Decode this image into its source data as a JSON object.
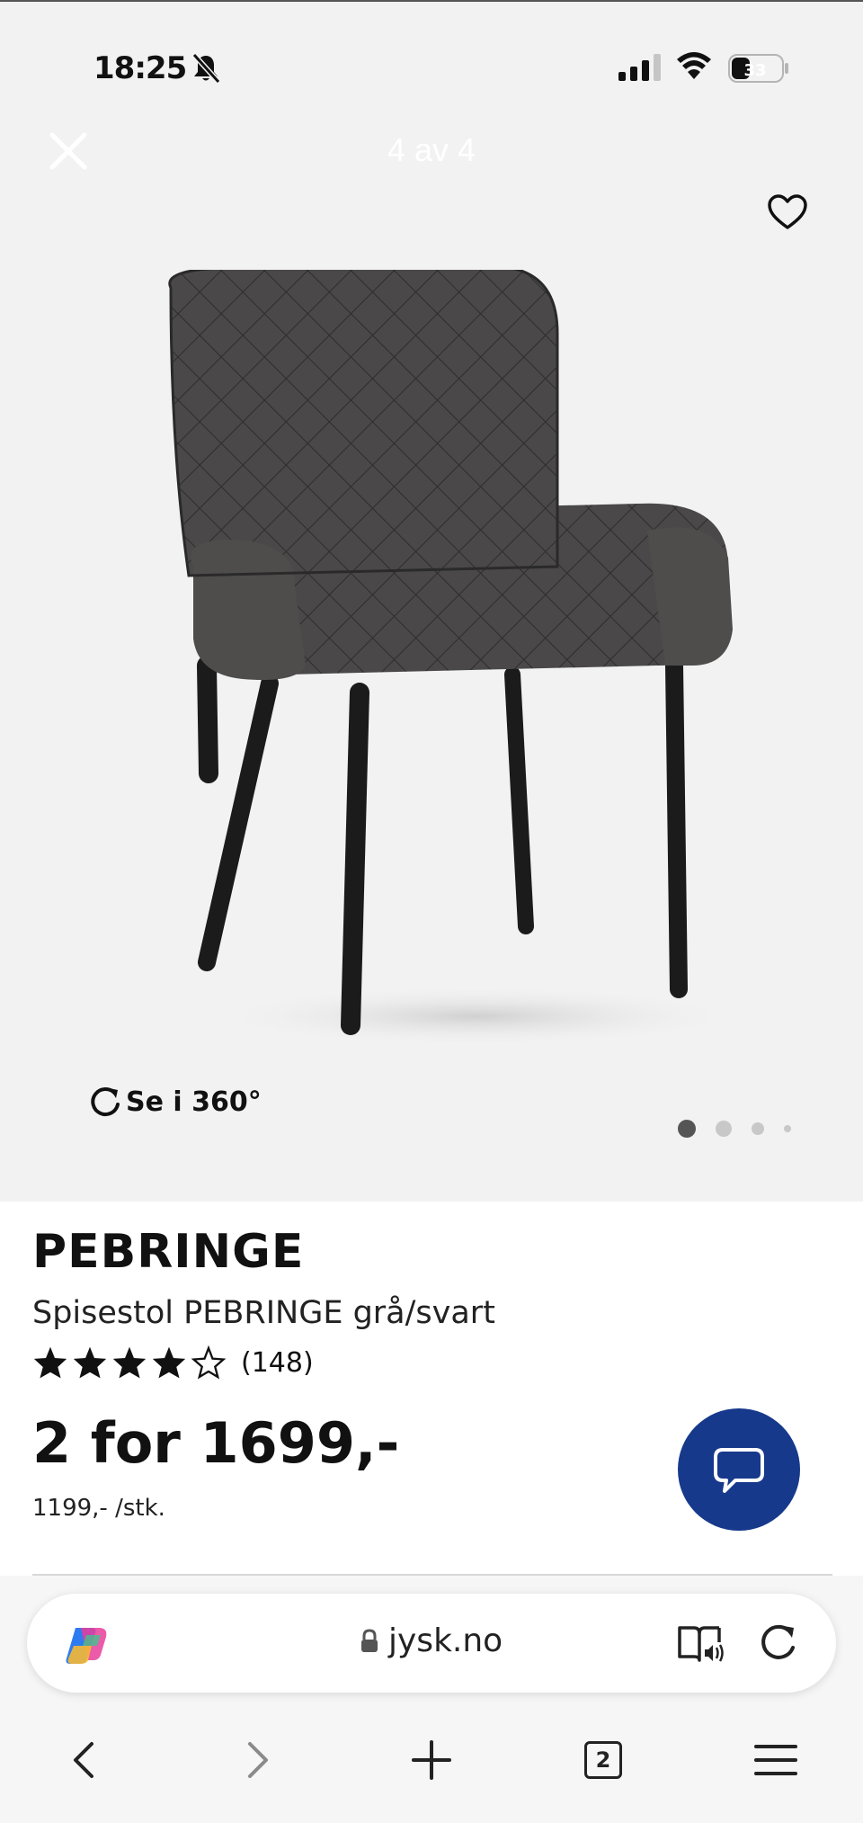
{
  "status_bar": {
    "time": "18:25",
    "icons": [
      "bell-slash-icon",
      "signal-icon",
      "wifi-icon",
      "battery-icon"
    ],
    "battery_level": "33"
  },
  "gallery": {
    "counter": "4 av 4",
    "close_icon": "close-icon",
    "favorite_icon": "heart-icon",
    "view_360_label": "Se i 360°",
    "total_images": 4,
    "active_index": 1
  },
  "product": {
    "name": "PEBRINGE",
    "description": "Spisestol PEBRINGE grå/svart",
    "rating": 4,
    "rating_max": 5,
    "review_count": "(148)",
    "price": "2 for 1699,-",
    "unit_price": "1199,- /stk."
  },
  "chat": {
    "icon": "chat-bubble-icon",
    "color": "#16398b"
  },
  "browser": {
    "url": "jysk.no",
    "tab_count": "2",
    "icons": [
      "copilot-icon",
      "lock-icon",
      "reader-aloud-icon",
      "reload-icon",
      "back-icon",
      "forward-icon",
      "new-tab-icon",
      "tabs-icon",
      "menu-icon"
    ]
  },
  "colors": {
    "hero_bg": "#f2f2f2",
    "chat_button": "#16398b",
    "text": "#111111"
  }
}
